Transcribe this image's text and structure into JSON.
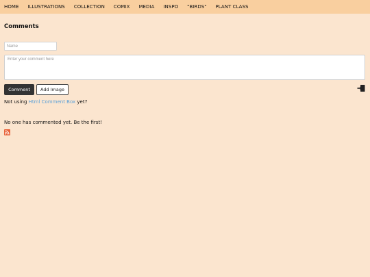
{
  "nav": {
    "items": [
      {
        "label": "HOME"
      },
      {
        "label": "ILLUSTRATIONS"
      },
      {
        "label": "COLLECTION"
      },
      {
        "label": "COMIX"
      },
      {
        "label": "MEDIA"
      },
      {
        "label": "INSPO"
      },
      {
        "label": "\"BIRDS\""
      },
      {
        "label": "PLANT CLASS"
      }
    ]
  },
  "comments": {
    "title": "Comments",
    "name_placeholder": "Name",
    "comment_placeholder": "Enter your comment here",
    "comment_button": "Comment",
    "add_image_button": "Add Image",
    "login_icon": "login-icon",
    "promo_prefix": "Not using",
    "promo_link": "Html Comment Box",
    "promo_suffix": "yet?",
    "empty_message": "No one has commented yet. Be the first!",
    "rss_icon": "rss-icon"
  },
  "colors": {
    "background": "#fbe5cf",
    "nav_background": "#f9cf9f",
    "link": "#5aa0d8",
    "button_dark": "#333333",
    "rss": "#e8633a"
  }
}
